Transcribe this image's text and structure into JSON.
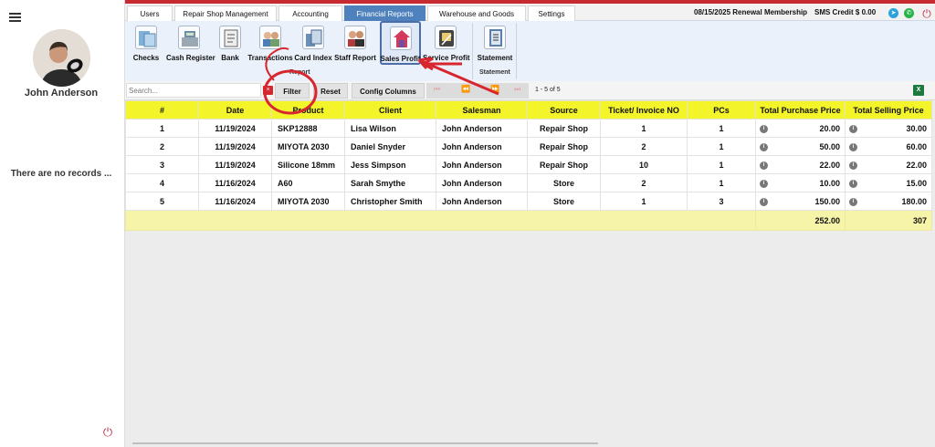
{
  "sidebar": {
    "user_name": "John Anderson",
    "empty_message": "There are no records ..."
  },
  "tabs": [
    {
      "label": "Users"
    },
    {
      "label": "Repair Shop Management"
    },
    {
      "label": "Accounting"
    },
    {
      "label": "Financial Reports",
      "active": true
    },
    {
      "label": "Warehouse and Goods"
    },
    {
      "label": "Settings"
    }
  ],
  "header": {
    "membership": "08/15/2025 Renewal Membership",
    "sms_credit": "SMS Credit $ 0.00"
  },
  "ribbon": {
    "items": [
      {
        "label": "Checks",
        "icon": "checks-icon"
      },
      {
        "label": "Cash Register",
        "icon": "cash-register-icon"
      },
      {
        "label": "Bank",
        "icon": "bank-icon"
      },
      {
        "label": "Transactions",
        "icon": "transactions-icon"
      },
      {
        "label": "Card Index",
        "icon": "card-index-icon"
      },
      {
        "label": "Staff Report",
        "icon": "staff-report-icon"
      },
      {
        "label": "Sales Profit",
        "icon": "sales-profit-icon",
        "selected": true
      },
      {
        "label": "Service Profit",
        "icon": "service-profit-icon"
      },
      {
        "label": "Statement",
        "icon": "statement-icon"
      }
    ],
    "group_report": "Report",
    "group_statement": "Statement"
  },
  "toolbar": {
    "search_placeholder": "Search...",
    "clear": "×",
    "filter": "Filter",
    "reset": "Reset",
    "config_columns": "Config Columns",
    "pager_first": "⏮",
    "pager_prev": "⏪",
    "pager_next": "⏩",
    "pager_last": "⏭",
    "page_info": "1 - 5 of 5",
    "excel": "X"
  },
  "table": {
    "columns": [
      "#",
      "Date",
      "Product",
      "Client",
      "Salesman",
      "Source",
      "Ticket/ Invoice NO",
      "PCs",
      "Total Purchase Price",
      "Total Selling Price"
    ],
    "rows": [
      [
        "1",
        "11/19/2024",
        "SKP12888",
        "Lisa Wilson",
        "John Anderson",
        "Repair Shop",
        "1",
        "1",
        "20.00",
        "30.00"
      ],
      [
        "2",
        "11/19/2024",
        "MIYOTA 2030",
        "Daniel Snyder",
        "John Anderson",
        "Repair Shop",
        "2",
        "1",
        "50.00",
        "60.00"
      ],
      [
        "3",
        "11/19/2024",
        "Silicone 18mm",
        "Jess Simpson",
        "John Anderson",
        "Repair Shop",
        "10",
        "1",
        "22.00",
        "22.00"
      ],
      [
        "4",
        "11/16/2024",
        "A60",
        "Sarah Smythe",
        "John Anderson",
        "Store",
        "2",
        "1",
        "10.00",
        "15.00"
      ],
      [
        "5",
        "11/16/2024",
        "MIYOTA 2030",
        "Christopher Smith",
        "John Anderson",
        "Store",
        "1",
        "3",
        "150.00",
        "180.00"
      ]
    ],
    "totals": {
      "purchase": "252.00",
      "selling": "307"
    }
  },
  "colors": {
    "accent": "#c82a32",
    "active_tab": "#4f81bd",
    "header_yellow": "#f4f42a",
    "annotation_red": "#d8262f"
  }
}
